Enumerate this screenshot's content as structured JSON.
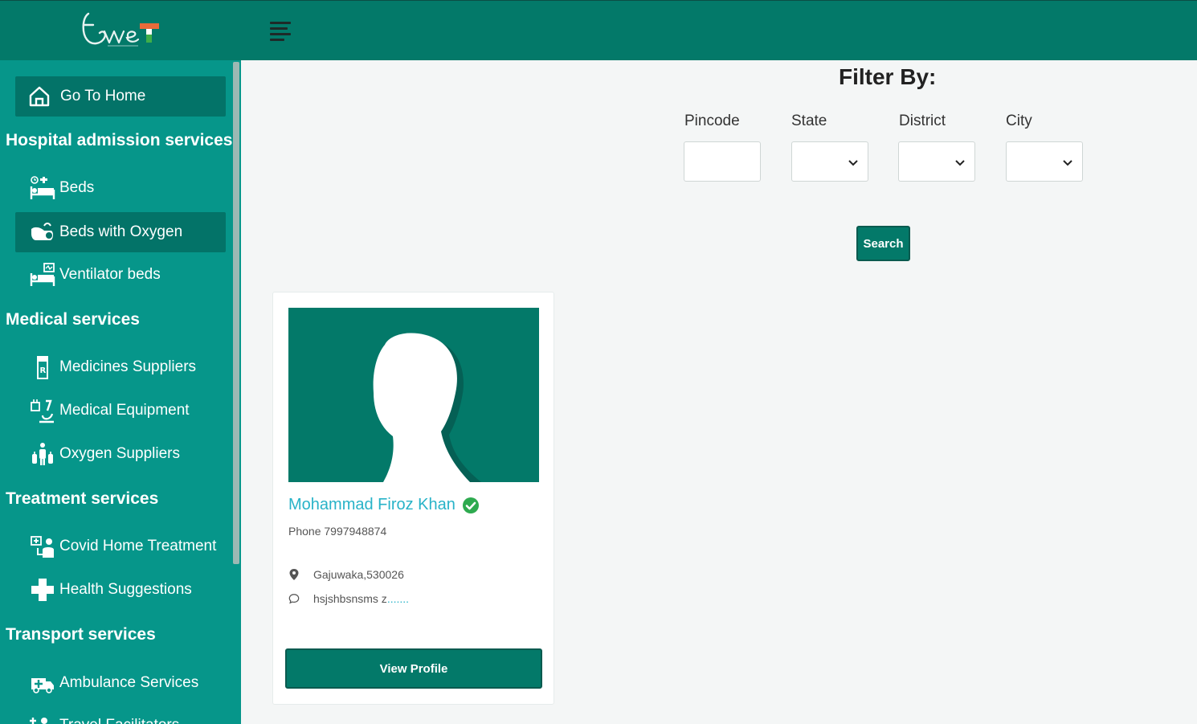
{
  "header": {
    "logo_icon": "twet-logo",
    "menu_icon": "hamburger-menu-icon"
  },
  "sidebar": {
    "home": {
      "label": "Go To Home",
      "icon": "home-icon"
    },
    "sections": [
      {
        "title": "Hospital admission services",
        "items": [
          {
            "label": "Beds",
            "icon": "hospital-bed-icon",
            "active": false
          },
          {
            "label": "Beds with Oxygen",
            "icon": "oxygen-bed-icon",
            "active": true
          },
          {
            "label": "Ventilator beds",
            "icon": "ventilator-bed-icon",
            "active": false
          }
        ]
      },
      {
        "title": "Medical services",
        "items": [
          {
            "label": "Medicines Suppliers",
            "icon": "prescription-bottle-icon"
          },
          {
            "label": "Medical Equipment",
            "icon": "microscope-icon"
          },
          {
            "label": "Oxygen Suppliers",
            "icon": "oxygen-cylinder-icon"
          }
        ]
      },
      {
        "title": "Treatment services",
        "items": [
          {
            "label": "Covid Home Treatment",
            "icon": "home-treatment-icon"
          },
          {
            "label": "Health Suggestions",
            "icon": "medical-cross-icon"
          }
        ]
      },
      {
        "title": "Transport services",
        "items": [
          {
            "label": "Ambulance Services",
            "icon": "ambulance-icon"
          },
          {
            "label": "Travel Facilitators",
            "icon": "travel-icon"
          }
        ]
      }
    ]
  },
  "filter": {
    "title": "Filter By:",
    "pincode_label": "Pincode",
    "pincode_value": "",
    "state_label": "State",
    "state_value": "",
    "district_label": "District",
    "district_value": "",
    "city_label": "City",
    "city_value": "",
    "search_label": "Search"
  },
  "card": {
    "name": "Mohammad Firoz Khan",
    "verified": true,
    "phone": "Phone 7997948874",
    "location": "Gajuwaka,530026",
    "message": "hsjshbsnsms z",
    "more": ".......",
    "view_label": "View Profile"
  },
  "colors": {
    "header": "#037969",
    "sidebar": "#06968a",
    "active_item": "#037368",
    "accent_link": "#28b3c8",
    "verified": "#2eaa4f"
  }
}
